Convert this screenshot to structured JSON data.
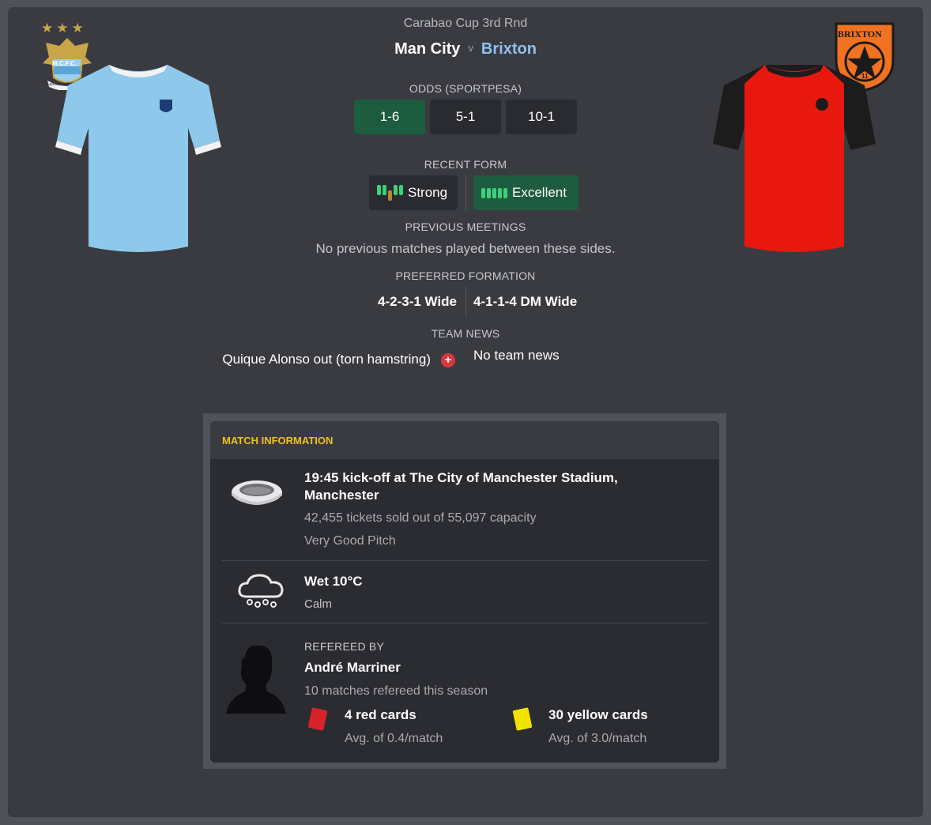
{
  "header": {
    "competition": "Carabao Cup 3rd Rnd",
    "home_team": "Man City",
    "vs": "v",
    "away_team": "Brixton"
  },
  "home_badge": {
    "stars": "★★★",
    "text": "M.C.F.C.",
    "motto": "Superbia in Proelio"
  },
  "away_badge": {
    "text": "BRIXTON",
    "number": "11"
  },
  "odds": {
    "label": "ODDS (SPORTPESA)",
    "home": "1-6",
    "draw": "5-1",
    "away": "10-1"
  },
  "recent_form": {
    "label": "RECENT FORM",
    "home": "Strong",
    "away": "Excellent"
  },
  "previous_meetings": {
    "label": "PREVIOUS MEETINGS",
    "text": "No previous matches played between these sides."
  },
  "preferred_formation": {
    "label": "PREFERRED FORMATION",
    "home": "4-2-3-1 Wide",
    "away": "4-1-1-4 DM Wide"
  },
  "team_news": {
    "label": "TEAM NEWS",
    "home": "Quique Alonso out (torn hamstring)",
    "away": "No team news"
  },
  "match_info": {
    "title": "MATCH INFORMATION",
    "venue": "19:45 kick-off at The City of Manchester Stadium, Manchester",
    "tickets": "42,455 tickets sold out of 55,097 capacity",
    "pitch": "Very Good Pitch",
    "weather": "Wet 10°C",
    "wind": "Calm",
    "referee_label": "REFEREED BY",
    "referee_name": "André Marriner",
    "referee_matches": "10 matches refereed this season",
    "red_cards": "4 red cards",
    "red_avg": "Avg. of 0.4/match",
    "yellow_cards": "30 yellow cards",
    "yellow_avg": "Avg. of 3.0/match"
  },
  "colors": {
    "home_shirt": "#8ec8ea",
    "away_shirt": "#e8180e",
    "away_sleeves": "#1c1c1c",
    "odds_favourite": "#1e5c3f",
    "form_green": "#3ad27a",
    "header_accent": "#f0c020"
  }
}
